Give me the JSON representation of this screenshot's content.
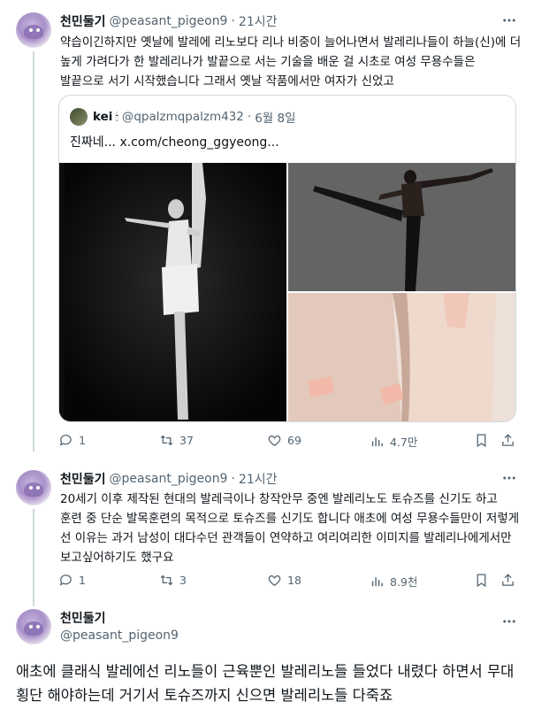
{
  "tweets": [
    {
      "name": "천민둘기",
      "handle": "@peasant_pigeon9",
      "time": "21시간",
      "text": "약습이긴하지만 옛날에 발레에 리노보다 리나 비중이 늘어나면서 발레리나들이 하늘(신)에 더 높게 가려다가 한 발레리나가 발끝으로 서는 기술을 배운 걸 시초로 여성 무용수들은 발끝으로 서기 시작했습니다 그래서 옛날 작품에서만 여자가 신었고",
      "quote": {
        "name": "kei",
        "handle": "@qpalzmqpalzm432",
        "date": "6월 8일",
        "text": "진짜네... x.com/cheong_ggyeong..."
      },
      "actions": {
        "replies": "1",
        "retweets": "37",
        "likes": "69",
        "views": "4.7만"
      }
    },
    {
      "name": "천민둘기",
      "handle": "@peasant_pigeon9",
      "time": "21시간",
      "text": "20세기 이후 제작된 현대의 발레극이나 창작안무 중엔 발레리노도 토슈즈를 신기도 하고 훈련 중 단순 발목훈련의 목적으로 토슈즈를 신기도 합니다 애초에 여성 무용수들만이 저렇게 선 이유는 과거 남성이 대다수던 관객들이 연약하고 여리여리한 이미지를 발레리나에게서만 보고싶어하기도 했구요",
      "actions": {
        "replies": "1",
        "retweets": "3",
        "likes": "18",
        "views": "8.9천"
      }
    },
    {
      "name": "천민둘기",
      "handle": "@peasant_pigeon9",
      "text": "애초에 클래식 발레에선 리노들이 근육뿐인 발레리노들 들었다 내렸다 하면서 무대횡단 해야하는데 거기서 토슈즈까지 신으면 발레리노들 다죽죠"
    }
  ],
  "icons": [
    "reply-icon",
    "retweet-icon",
    "like-icon",
    "views-icon",
    "bookmark-icon",
    "share-icon",
    "more-icon"
  ],
  "colors": {
    "text": "#0f1419",
    "muted": "#536471",
    "border": "#cfd9de"
  }
}
